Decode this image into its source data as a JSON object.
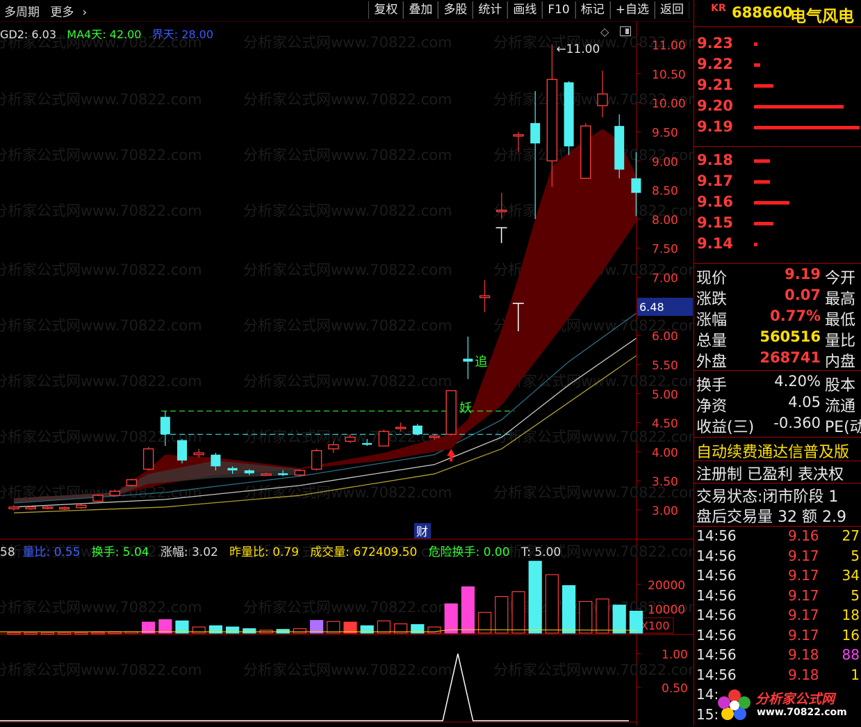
{
  "topbar": {
    "left_items": [
      "多周期",
      "更多"
    ],
    "chevron_icon": "chevron-right-icon",
    "tools": [
      "复权",
      "叠加",
      "多股",
      "统计",
      "画线",
      "F10",
      "标记",
      "+自选",
      "返回"
    ]
  },
  "main_legend": {
    "gd2": "GD2: 6.03",
    "ma4": "MA4天: 42.00",
    "jie": "界天: 28.00",
    "colors": {
      "gd2": "#e0e0e0",
      "ma4": "#33ff33",
      "jie": "#3a5bff"
    }
  },
  "price_axis": {
    "ticks": [
      "11.00",
      "10.50",
      "10.00",
      "9.50",
      "9.00",
      "8.50",
      "8.00",
      "7.50",
      "7.00",
      "6.50",
      "6.00",
      "5.50",
      "5.00",
      "4.50",
      "4.00",
      "3.50",
      "3.00"
    ],
    "current_label": "6.48"
  },
  "chart_annotations": {
    "high_label": "11.00",
    "zhui": "追",
    "yao": "妖",
    "cai": "财"
  },
  "watermark": "分析家公式网www.70822.com",
  "volume_legend": {
    "prefix": "58",
    "liangbi": "量比: 0.55",
    "huanshou": "换手: 5.04",
    "zhangfu": "涨幅: 3.02",
    "zuoliangbi": "昨量比: 0.79",
    "chengjiao": "成交量: 672409.50",
    "weixian": "危险换手: 0.00",
    "t": "T: 5.00"
  },
  "volume_axis": {
    "ticks": [
      "20000",
      "10000"
    ],
    "unit": "X100"
  },
  "indicator_axis": {
    "ticks": [
      "1.00",
      "0.50"
    ]
  },
  "quote": {
    "market_tag": "KR",
    "code": "688660",
    "name": "电气风电",
    "asks": [
      {
        "price": "9.23",
        "vol": 1
      },
      {
        "price": "9.22",
        "vol": 2
      },
      {
        "price": "9.21",
        "vol": 6
      },
      {
        "price": "9.20",
        "vol": 28
      },
      {
        "price": "9.19",
        "vol": 33
      }
    ],
    "bids": [
      {
        "price": "9.18",
        "vol": 5
      },
      {
        "price": "9.17",
        "vol": 5
      },
      {
        "price": "9.16",
        "vol": 11
      },
      {
        "price": "9.15",
        "vol": 6
      },
      {
        "price": "9.14",
        "vol": 1
      }
    ],
    "stats": [
      {
        "label": "现价",
        "value": "9.19",
        "label2": "今开"
      },
      {
        "label": "涨跌",
        "value": "0.07",
        "label2": "最高"
      },
      {
        "label": "涨幅",
        "value": "0.77%",
        "label2": "最低"
      },
      {
        "label": "总量",
        "value": "560516",
        "label2": "量比"
      },
      {
        "label": "外盘",
        "value": "268741",
        "label2": "内盘"
      }
    ],
    "stats2": [
      {
        "label": "换手",
        "value": "4.20%",
        "label2": "股本"
      },
      {
        "label": "净资",
        "value": "4.05",
        "label2": "流通"
      },
      {
        "label": "收益(三)",
        "value": "-0.360",
        "label2": "PE(动"
      }
    ],
    "promo": "自动续费通达信普及版",
    "tags": "注册制 已盈利 表决权",
    "status": "交易状态:闭市阶段 1",
    "afterhours": "盘后交易量 32 额 2.9",
    "ticks": [
      {
        "time": "14:56",
        "price": "9.16",
        "vol": "27"
      },
      {
        "time": "14:56",
        "price": "9.17",
        "vol": "5"
      },
      {
        "time": "14:56",
        "price": "9.17",
        "vol": "34"
      },
      {
        "time": "14:56",
        "price": "9.17",
        "vol": "5"
      },
      {
        "time": "14:56",
        "price": "9.17",
        "vol": "18"
      },
      {
        "time": "14:56",
        "price": "9.17",
        "vol": "16"
      },
      {
        "time": "14:56",
        "price": "9.18",
        "vol": "88"
      },
      {
        "time": "14:56",
        "price": "9.18",
        "vol": "1"
      },
      {
        "time": "14:",
        "price": "",
        "vol": ""
      },
      {
        "time": "15:",
        "price": "",
        "vol": ""
      }
    ],
    "logo_text": "分析家公式网",
    "logo_url": "www.70822.com"
  },
  "candles": [
    {
      "o": 3.05,
      "c": 3.02,
      "h": 3.08,
      "l": 2.99
    },
    {
      "o": 3.02,
      "c": 3.05,
      "h": 3.07,
      "l": 3.0
    },
    {
      "o": 3.05,
      "c": 3.03,
      "h": 3.08,
      "l": 3.01
    },
    {
      "o": 3.03,
      "c": 3.04,
      "h": 3.06,
      "l": 3.0
    },
    {
      "o": 3.04,
      "c": 3.08,
      "h": 3.1,
      "l": 3.02
    },
    {
      "o": 3.15,
      "c": 3.25,
      "h": 3.27,
      "l": 3.12
    },
    {
      "o": 3.25,
      "c": 3.32,
      "h": 3.35,
      "l": 3.22
    },
    {
      "o": 3.42,
      "c": 3.52,
      "h": 3.54,
      "l": 3.4
    },
    {
      "o": 3.7,
      "c": 4.05,
      "h": 4.08,
      "l": 3.68
    },
    {
      "o": 4.3,
      "c": 4.6,
      "h": 4.7,
      "l": 4.1,
      "cyan": true,
      "r": true
    },
    {
      "o": 4.2,
      "c": 3.85,
      "h": 4.22,
      "l": 3.8,
      "cyan": true
    },
    {
      "o": 3.98,
      "c": 3.95,
      "h": 4.05,
      "l": 3.9
    },
    {
      "o": 3.95,
      "c": 3.75,
      "h": 3.98,
      "l": 3.68,
      "cyan": true
    },
    {
      "o": 3.72,
      "c": 3.68,
      "h": 3.75,
      "l": 3.62,
      "cyan": true
    },
    {
      "o": 3.68,
      "c": 3.63,
      "h": 3.7,
      "l": 3.6,
      "cyan": true
    },
    {
      "o": 3.62,
      "c": 3.6,
      "h": 3.64,
      "l": 3.58
    },
    {
      "o": 3.6,
      "c": 3.63,
      "h": 3.68,
      "l": 3.58,
      "cyan": true
    },
    {
      "o": 3.6,
      "c": 3.68,
      "h": 3.7,
      "l": 3.58
    },
    {
      "o": 3.7,
      "c": 4.02,
      "h": 4.05,
      "l": 3.68
    },
    {
      "o": 4.05,
      "c": 4.12,
      "h": 4.18,
      "l": 3.98
    },
    {
      "o": 4.18,
      "c": 4.25,
      "h": 4.3,
      "l": 4.15
    },
    {
      "o": 4.15,
      "c": 4.12,
      "h": 4.22,
      "l": 4.1,
      "cyan": true
    },
    {
      "o": 4.1,
      "c": 4.35,
      "h": 4.38,
      "l": 4.1
    },
    {
      "o": 4.42,
      "c": 4.42,
      "h": 4.5,
      "l": 4.35
    },
    {
      "o": 4.45,
      "c": 4.3,
      "h": 4.48,
      "l": 4.28,
      "cyan": true
    },
    {
      "o": 4.25,
      "c": 4.27,
      "h": 4.3,
      "l": 4.2
    },
    {
      "o": 4.3,
      "c": 5.05,
      "h": 5.05,
      "l": 4.28
    },
    {
      "o": 5.6,
      "c": 5.55,
      "h": 5.98,
      "l": 5.25,
      "cyan": true
    },
    {
      "o": 6.65,
      "c": 6.68,
      "h": 6.95,
      "l": 6.4
    },
    {
      "o": 8.15,
      "c": 8.15,
      "h": 8.45,
      "l": 8.0
    },
    {
      "o": 9.45,
      "c": 9.43,
      "h": 9.5,
      "l": 9.15
    },
    {
      "o": 9.65,
      "c": 9.3,
      "h": 10.2,
      "l": 8.0,
      "cyan": true
    },
    {
      "o": 9.0,
      "c": 10.4,
      "h": 11.0,
      "l": 8.55
    },
    {
      "o": 10.35,
      "c": 9.25,
      "h": 10.37,
      "l": 9.1,
      "cyan": true
    },
    {
      "o": 8.7,
      "c": 9.6,
      "h": 9.65,
      "l": 8.7
    },
    {
      "o": 9.95,
      "c": 10.15,
      "h": 10.55,
      "l": 9.75
    },
    {
      "o": 9.6,
      "c": 8.85,
      "h": 9.8,
      "l": 8.7,
      "cyan": true
    },
    {
      "o": 8.7,
      "c": 8.45,
      "h": 9.15,
      "l": 8.05,
      "cyan": true
    }
  ],
  "volumes": [
    {
      "v": 150
    },
    {
      "v": 120
    },
    {
      "v": 120
    },
    {
      "v": 100
    },
    {
      "v": 150
    },
    {
      "v": 300
    },
    {
      "v": 400
    },
    {
      "v": 600
    },
    {
      "v": 4500,
      "pink": true
    },
    {
      "v": 5500,
      "pink": true
    },
    {
      "v": 5000,
      "cyan": true
    },
    {
      "v": 2500
    },
    {
      "v": 3000,
      "cyan": true
    },
    {
      "v": 2500,
      "cyan": true
    },
    {
      "v": 1800,
      "cyan": true
    },
    {
      "v": 1200
    },
    {
      "v": 1500,
      "cyan": true
    },
    {
      "v": 1800
    },
    {
      "v": 5200,
      "purple": true
    },
    {
      "v": 4800
    },
    {
      "v": 4500,
      "solid": true
    },
    {
      "v": 3000,
      "cyan": true
    },
    {
      "v": 5000
    },
    {
      "v": 3800
    },
    {
      "v": 3500,
      "cyan": true
    },
    {
      "v": 2500
    },
    {
      "v": 12000,
      "pink": true
    },
    {
      "v": 19000,
      "pink": true
    },
    {
      "v": 8500
    },
    {
      "v": 15000
    },
    {
      "v": 17000
    },
    {
      "v": 29500,
      "cyan": true
    },
    {
      "v": 24000
    },
    {
      "v": 19500,
      "cyan": true
    },
    {
      "v": 13000
    },
    {
      "v": 14000
    },
    {
      "v": 11500,
      "cyan": true
    },
    {
      "v": 9000,
      "cyan": true
    }
  ],
  "ma_lines": [
    {
      "color": "#2b6f84",
      "pts": [
        [
          0,
          3.12
        ],
        [
          9,
          3.3
        ],
        [
          17,
          3.58
        ],
        [
          25,
          3.95
        ],
        [
          29,
          4.55
        ],
        [
          33,
          5.55
        ],
        [
          37,
          6.38
        ]
      ]
    },
    {
      "color": "#c9c9c9",
      "pts": [
        [
          0,
          3.05
        ],
        [
          9,
          3.18
        ],
        [
          17,
          3.42
        ],
        [
          25,
          3.78
        ],
        [
          29,
          4.25
        ],
        [
          33,
          5.15
        ],
        [
          37,
          5.95
        ]
      ]
    },
    {
      "color": "#b0a030",
      "pts": [
        [
          0,
          2.95
        ],
        [
          9,
          3.05
        ],
        [
          17,
          3.25
        ],
        [
          25,
          3.62
        ],
        [
          29,
          4.05
        ],
        [
          33,
          4.85
        ],
        [
          37,
          5.65
        ]
      ]
    }
  ]
}
